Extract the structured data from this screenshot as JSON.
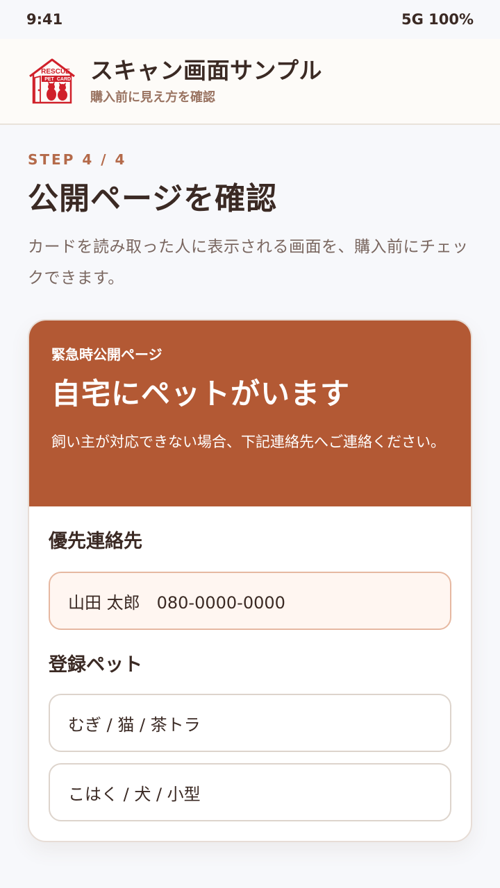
{
  "status_bar": {
    "time": "9:41",
    "signal": "5G 100%"
  },
  "header": {
    "logo_text": {
      "line1": "RESCUE",
      "line2": "PET",
      "line3": "CARD"
    },
    "title": "スキャン画面サンプル",
    "subtitle": "購入前に見え方を確認"
  },
  "main": {
    "step": "STEP 4 / 4",
    "title": "公開ページを確認",
    "description": "カードを読み取った人に表示される画面を、購入前にチェックできます。"
  },
  "card": {
    "eyebrow": "緊急時公開ページ",
    "headline": "自宅にペットがいます",
    "note": "飼い主が対応できない場合、下記連絡先へご連絡ください。",
    "priority_contact_label": "優先連絡先",
    "priority_contact": "山田 太郎　080-0000-0000",
    "pets_label": "登録ペット",
    "pets": [
      {
        "text": "むぎ / 猫 / 茶トラ"
      },
      {
        "text": "こはく / 犬 / 小型"
      }
    ]
  },
  "colors": {
    "accent": "#b35934",
    "step": "#b46a4a",
    "logo_red": "#d0202a"
  }
}
